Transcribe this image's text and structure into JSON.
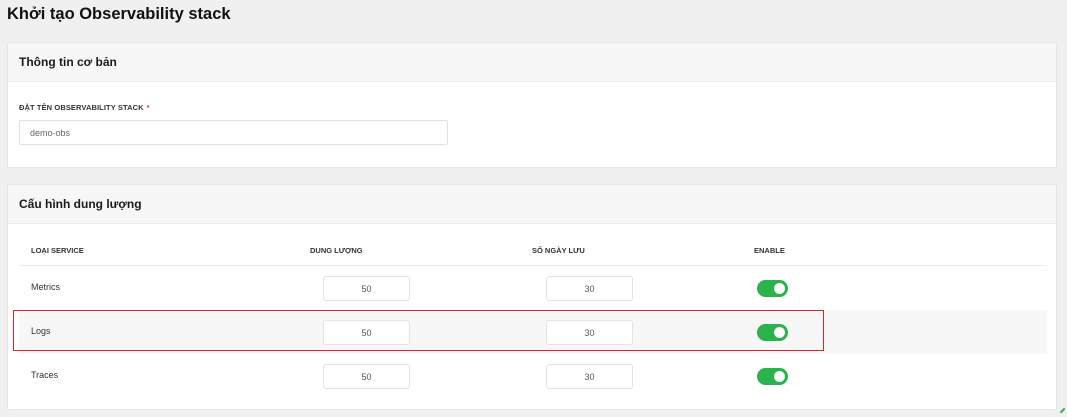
{
  "page": {
    "title": "Khởi tạo Observability stack"
  },
  "basic_info": {
    "header": "Thông tin cơ bản",
    "name_field": {
      "label": "ĐẶT TÊN OBSERVABILITY STACK",
      "required_mark": "*",
      "value": "demo-obs"
    }
  },
  "capacity": {
    "header": "Cấu hình dung lượng",
    "columns": {
      "service_type": "LOẠI SERVICE",
      "capacity": "DUNG LƯỢNG",
      "retention_days": "SỐ NGÀY LƯU",
      "enable": "ENABLE"
    },
    "rows": [
      {
        "service": "Metrics",
        "capacity": "50",
        "retention_days": "30",
        "enabled": true
      },
      {
        "service": "Logs",
        "capacity": "50",
        "retention_days": "30",
        "enabled": true
      },
      {
        "service": "Traces",
        "capacity": "50",
        "retention_days": "30",
        "enabled": true
      }
    ]
  },
  "colors": {
    "toggle_on": "#29b34a",
    "highlight": "#d9262b",
    "required": "#e53935"
  }
}
